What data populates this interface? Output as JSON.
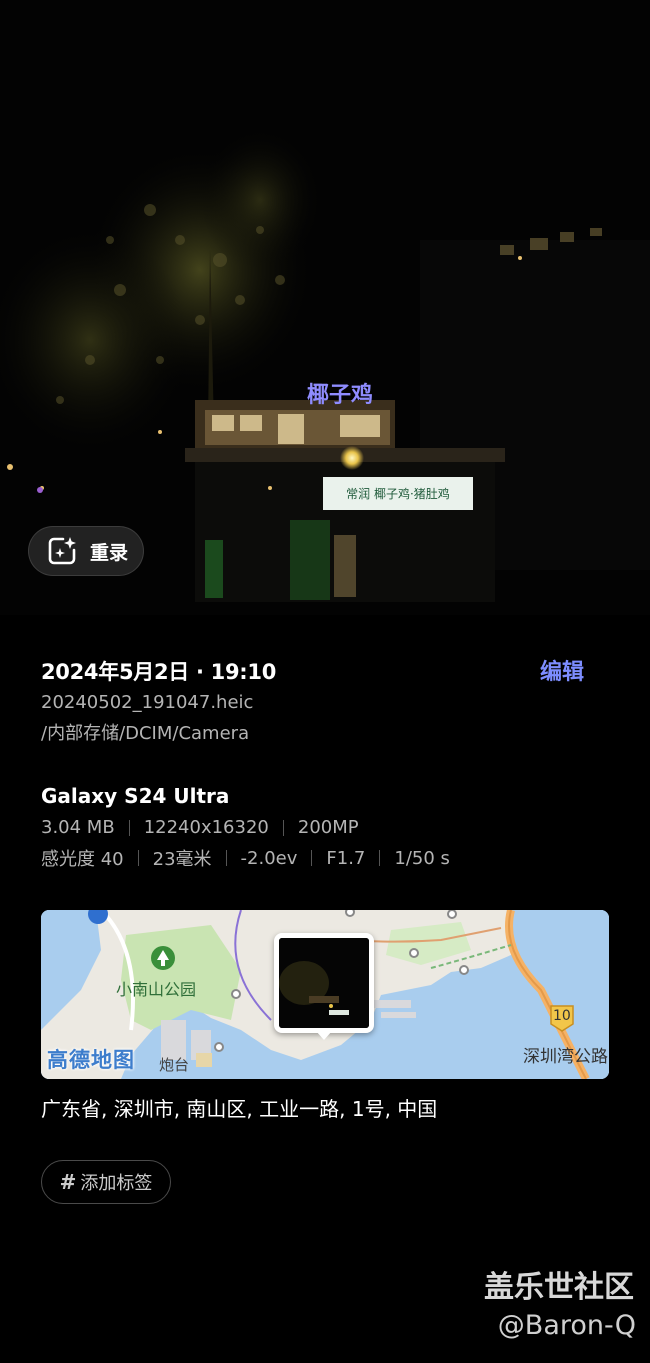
{
  "photo": {
    "sign_top": "椰子鸡",
    "sign_lower": "常润  椰子鸡·猪肚鸡"
  },
  "remaster_button": {
    "label": "重录",
    "icon": "sparkle-photo-icon"
  },
  "info": {
    "datetime": "2024年5月2日 · 19:10",
    "edit_label": "编辑",
    "filename": "20240502_191047.heic",
    "path": "/内部存储/DCIM/Camera"
  },
  "camera": {
    "device": "Galaxy S24 Ultra",
    "size": "3.04 MB",
    "resolution": "12240x16320",
    "megapixels": "200MP",
    "iso": "感光度 40",
    "focal": "23毫米",
    "ev": "-2.0ev",
    "aperture": "F1.7",
    "shutter": "1/50 s"
  },
  "map": {
    "park_label": "小南山公园",
    "road_number": "10",
    "road_label": "深圳湾公路",
    "provider": "高德地图",
    "near_label": "炮台"
  },
  "address": "广东省, 深圳市, 南山区, 工业一路, 1号, 中国",
  "tag_button": {
    "label": "添加标签",
    "icon": "hash-icon"
  },
  "watermark": {
    "line1": "盖乐世社区",
    "line2": "@Baron-Q"
  },
  "colors": {
    "accent": "#7d8dff",
    "background": "#000000"
  }
}
